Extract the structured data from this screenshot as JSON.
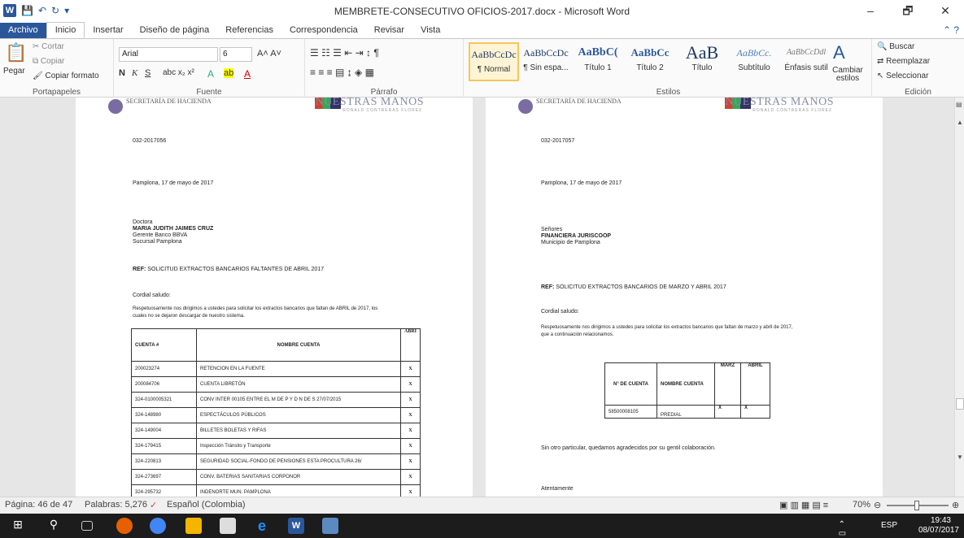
{
  "window": {
    "title": "MEMBRETE-CONSECUTIVO OFICIOS-2017.docx - Microsoft Word",
    "minimize": "–",
    "restore": "🗗",
    "close": "✕"
  },
  "tabs": [
    "Archivo",
    "Inicio",
    "Insertar",
    "Diseño de página",
    "Referencias",
    "Correspondencia",
    "Revisar",
    "Vista"
  ],
  "ribbon": {
    "clipboard": {
      "paste": "Pegar",
      "cut": "Cortar",
      "copy": "Copiar",
      "format_painter": "Copiar formato",
      "label": "Portapapeles"
    },
    "font": {
      "family": "Arial",
      "size": "6",
      "label": "Fuente"
    },
    "paragraph": {
      "label": "Párrafo"
    },
    "styles": {
      "items": [
        {
          "preview": "AaBbCcDc",
          "name": "¶ Normal"
        },
        {
          "preview": "AaBbCcDc",
          "name": "¶ Sin espa..."
        },
        {
          "preview": "AaBbC(",
          "name": "Título 1"
        },
        {
          "preview": "AaBbCc",
          "name": "Título 2"
        },
        {
          "preview": "AaB",
          "name": "Título"
        },
        {
          "preview": "AaBbCc.",
          "name": "Subtítulo"
        },
        {
          "preview": "AaBbCcDdl",
          "name": "Énfasis sutil"
        }
      ],
      "change": "Cambiar estilos",
      "label": "Estilos"
    },
    "editing": {
      "find": "Buscar",
      "replace": "Reemplazar",
      "select": "Seleccionar",
      "label": "Edición"
    }
  },
  "letterhead": {
    "left_small": "SECRETARÍA DE HACIENDA",
    "right": "NUESTRAS MANOS",
    "right_sub": "RONALD CONTRERAS FLOREZ"
  },
  "page1": {
    "number": "032-2017056",
    "date": "Pamplona,  17 de mayo de 2017",
    "to": [
      "Doctora",
      "MARIA JUDITH JAIMES CRUZ",
      "Gerente Banco BBVA",
      "Sucursal Pamplona"
    ],
    "ref_label": "REF:",
    "ref": "SOLICITUD EXTRACTOS BANCARIOS FALTANTES DE ABRIL 2017",
    "greeting": "Cordial saludo:",
    "body1": "Respetuosamente nos dirigimos a ustedes para solicitar los extractos bancarios que faltan de ABRIL  de 2017,  los",
    "body2": "cuales no se dejaron descargar de nuestro sistema.",
    "table_headers": [
      "CUENTA #",
      "NOMBRE CUENTA",
      "ABRI"
    ],
    "rows": [
      [
        "200023274",
        "RETENCION EN LA FUENTE",
        "X"
      ],
      [
        "200084706",
        "CUENTA LIBRETÓN",
        "X"
      ],
      [
        "324-0100005321",
        "CONV INTER 00105 ENTRE EL M DE P Y D N DE S 27/07/2015",
        "X"
      ],
      [
        "324-148980",
        "ESPECTÁCULOS PÚBLICOS",
        "X"
      ],
      [
        "324-149004",
        "BILLETES BOLETAS Y RIFAS",
        "X"
      ],
      [
        "324-179415",
        "Inspección Tránsito y Transporte",
        "X"
      ],
      [
        "324-220813",
        "SEGURIDAD SOCIAL-FONDO DE PENSIONES ESTA PROCULTURA  26/",
        "X"
      ],
      [
        "324-273697",
        "CONV. BATERIAS SANITARIAS CORPONOR",
        "X"
      ],
      [
        "324-295732",
        "INDENORTE MUN. PAMPLONA",
        "X"
      ]
    ]
  },
  "page2": {
    "number": "032-2017057",
    "date": "Pamplona,  17 de mayo de 2017",
    "to": [
      "Señores",
      "FINANCIERA JURISCOOP",
      "Municipio de Pamplona"
    ],
    "ref_label": "REF:",
    "ref": "SOLICITUD EXTRACTOS BANCARIOS DE MARZO Y  ABRIL 2017",
    "greeting": "Cordial saludo:",
    "body1": "Respetuosamente nos dirigimos a ustedes para solicitar los extractos bancarios que faltan de marzo y abril de 2017,",
    "body2": "que a continuación relacionamos.",
    "table_headers": [
      "N° DE CUENTA",
      "NOMBRE CUENTA",
      "MARZ",
      "ABRIL"
    ],
    "rows": [
      [
        "58500008105",
        "PREDIAL",
        "X",
        "X"
      ]
    ],
    "closing": "Sin otro particular, quedamos agradecidos por su gentil colaboración.",
    "signoff": "Atentamente"
  },
  "status": {
    "page": "Página: 46 de 47",
    "words": "Palabras: 5,276",
    "language": "Español (Colombia)",
    "zoom": "70%"
  },
  "tray": {
    "lang": "ESP",
    "time": "19:43",
    "date": "08/07/2017"
  }
}
